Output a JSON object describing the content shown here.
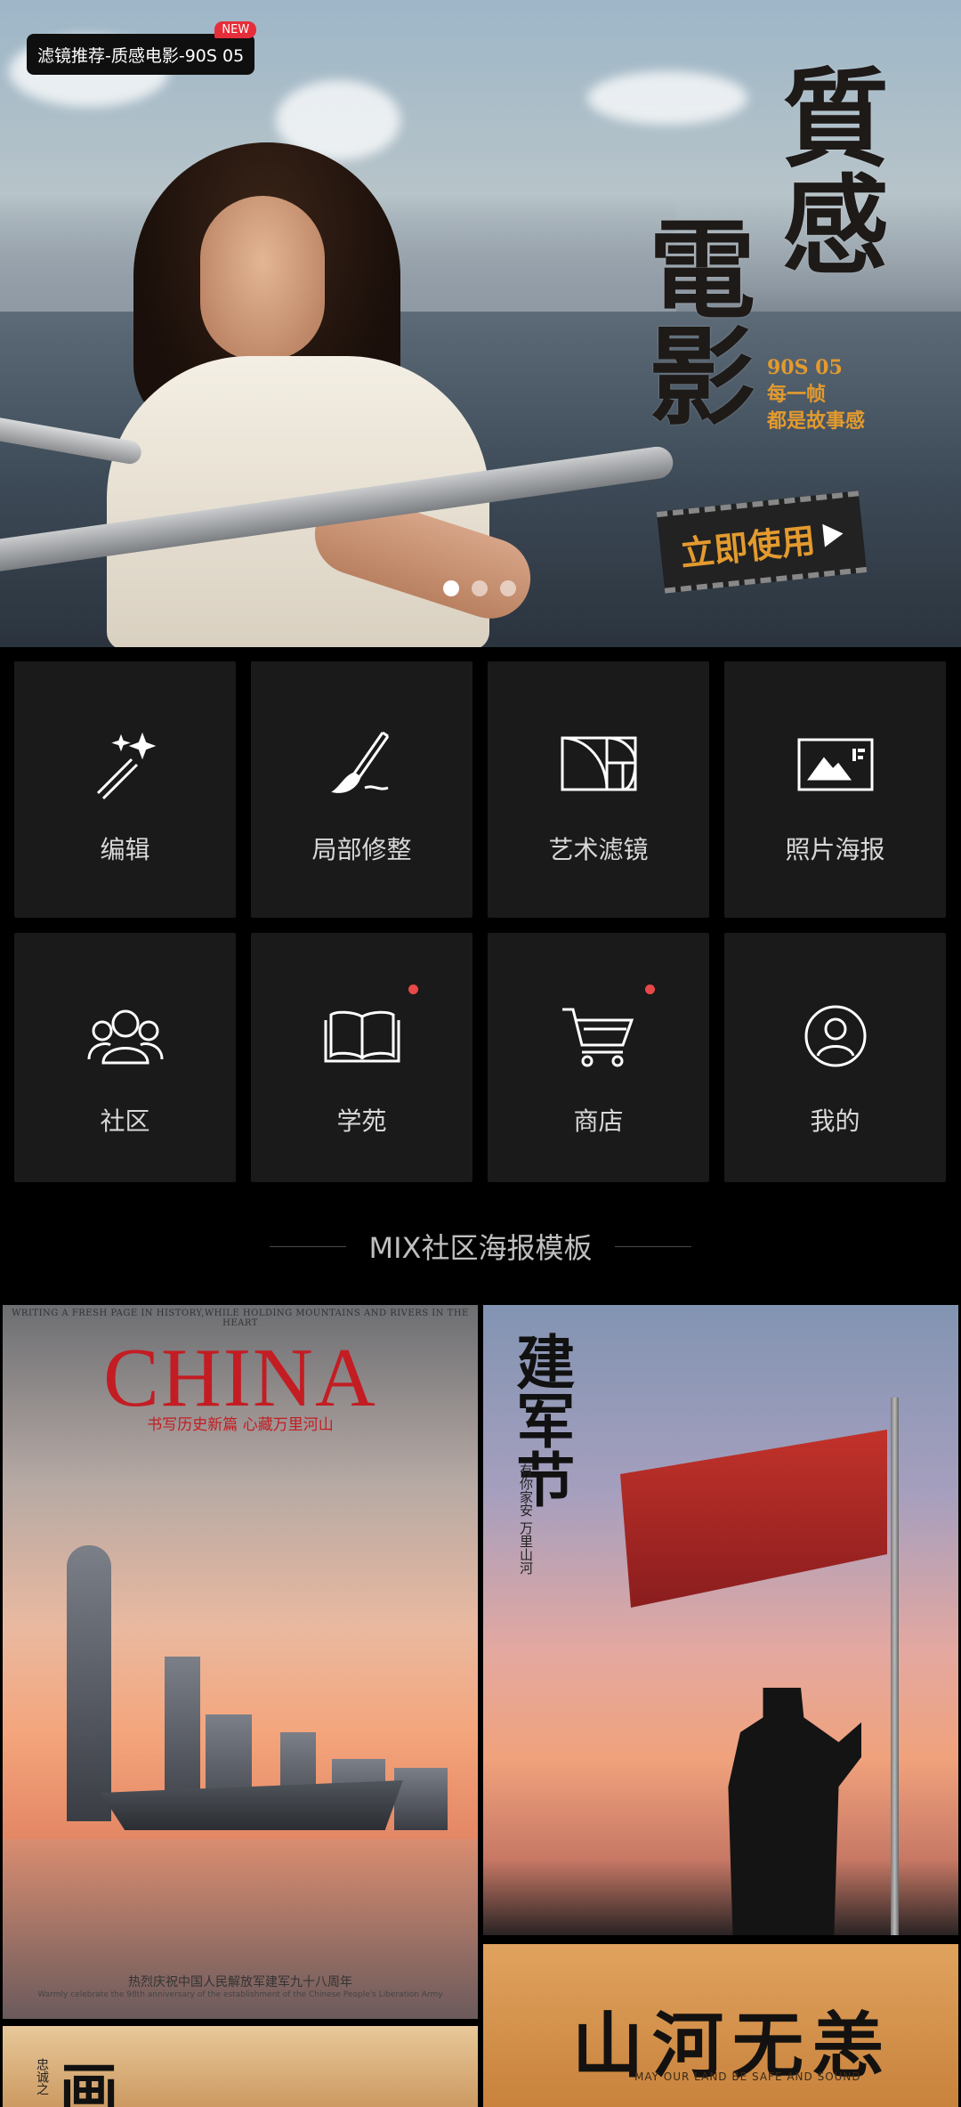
{
  "banner": {
    "tag_text": "滤镜推荐-质感电影-90S 05",
    "tag_badge": "NEW",
    "title_col1": "電影",
    "title_col2": "質感",
    "sub_line1": "90S 05",
    "sub_line2": "每一帧",
    "sub_line3": "都是故事感",
    "cta_label": "立即使用",
    "carousel_count": 3,
    "carousel_active": 1
  },
  "tools": [
    {
      "label": "编辑",
      "icon": "magic-wand-icon",
      "badge": false
    },
    {
      "label": "局部修整",
      "icon": "brush-icon",
      "badge": false
    },
    {
      "label": "艺术滤镜",
      "icon": "golden-ratio-icon",
      "badge": false
    },
    {
      "label": "照片海报",
      "icon": "photo-poster-icon",
      "badge": false
    },
    {
      "label": "社区",
      "icon": "community-icon",
      "badge": false
    },
    {
      "label": "学苑",
      "icon": "book-icon",
      "badge": true
    },
    {
      "label": "商店",
      "icon": "cart-icon",
      "badge": true
    },
    {
      "label": "我的",
      "icon": "profile-icon",
      "badge": false
    }
  ],
  "section_title": "MIX社区海报模板",
  "posters": [
    {
      "top_line": "WRITING A FRESH PAGE IN HISTORY,WHILE HOLDING MOUNTAINS AND RIVERS IN THE HEART",
      "title": "CHINA",
      "subtitle": "书写历史新篇 心藏万里河山",
      "bottom_cn": "热烈庆祝中国人民解放军建军九十八周年",
      "bottom_en": "Warmly celebrate the 98th anniversary of the establishment of the Chinese People's Liberation Army"
    },
    {
      "title": "建军节",
      "side_text": "有你家安 万里山河"
    },
    {
      "title": "山河无恙",
      "en": "MAY OUR LAND  BE SAFE AND SOUND"
    },
    {
      "title": "画",
      "side_text": "忠诚之"
    }
  ],
  "colors": {
    "background": "#000000",
    "tile": "#1a1a1a",
    "accent_red": "#e94848",
    "accent_orange": "#e39a2e"
  }
}
